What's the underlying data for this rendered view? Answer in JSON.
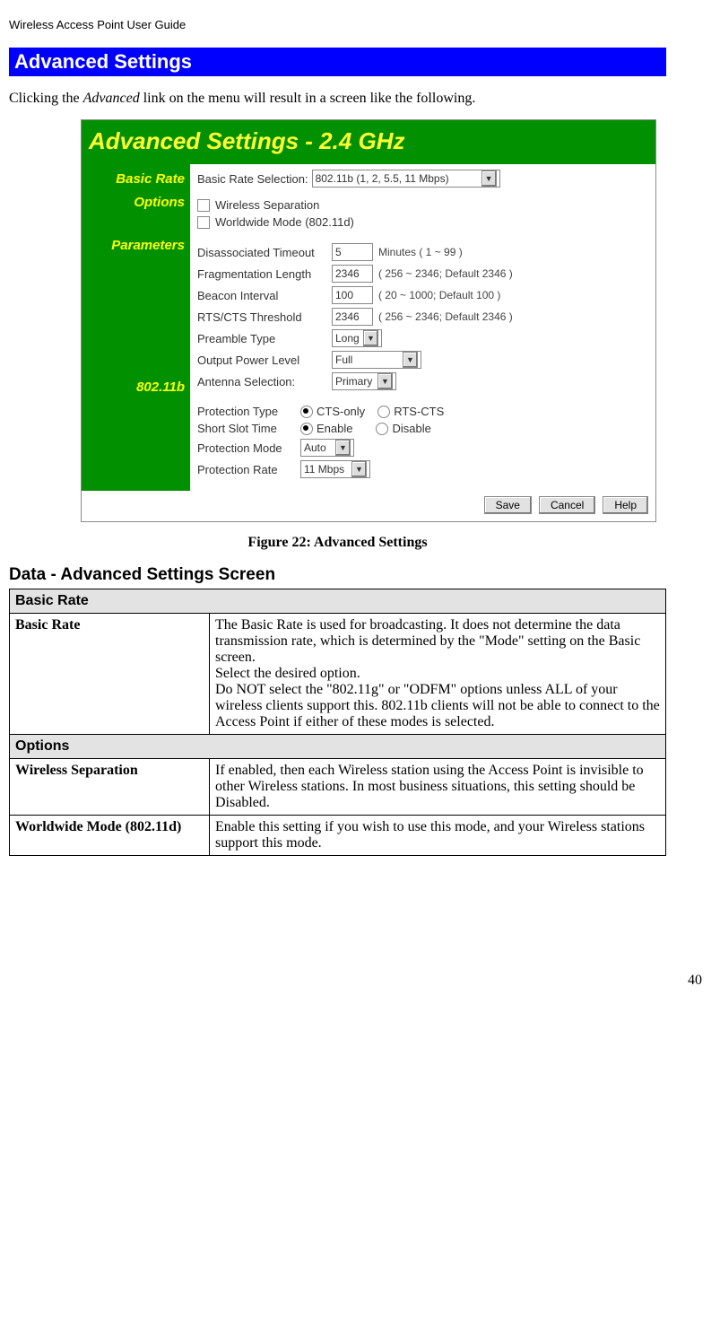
{
  "header": {
    "title": "Wireless Access Point User Guide"
  },
  "section": {
    "title": "Advanced Settings"
  },
  "intro": {
    "pre": "Clicking the ",
    "link": "Advanced",
    "post": " link on the menu will result in a screen like the following."
  },
  "figure": {
    "panel_title": "Advanced Settings - 2.4 GHz",
    "left_labels": {
      "basic_rate": "Basic Rate",
      "options": "Options",
      "parameters": "Parameters",
      "eight02_11b": "802.11b"
    },
    "basic_rate": {
      "label": "Basic Rate Selection:",
      "value": "802.11b (1, 2, 5.5, 11 Mbps)"
    },
    "options": {
      "wireless_sep": "Wireless Separation",
      "worldwide": "Worldwide Mode (802.11d)"
    },
    "parameters": {
      "disassoc_label": "Disassociated Timeout",
      "disassoc_value": "5",
      "disassoc_hint": "Minutes ( 1 ~ 99 )",
      "frag_label": "Fragmentation Length",
      "frag_value": "2346",
      "frag_hint": "( 256 ~ 2346; Default 2346 )",
      "beacon_label": "Beacon Interval",
      "beacon_value": "100",
      "beacon_hint": "( 20 ~ 1000; Default 100 )",
      "rts_label": "RTS/CTS Threshold",
      "rts_value": "2346",
      "rts_hint": "( 256 ~ 2346; Default 2346 )",
      "preamble_label": "Preamble Type",
      "preamble_value": "Long",
      "output_label": "Output Power Level",
      "output_value": "Full",
      "antenna_label": "Antenna Selection:",
      "antenna_value": "Primary"
    },
    "eight02_11b": {
      "prot_type_label": "Protection Type",
      "prot_type_cts": "CTS-only",
      "prot_type_rts": "RTS-CTS",
      "slot_label": "Short Slot Time",
      "slot_enable": "Enable",
      "slot_disable": "Disable",
      "prot_mode_label": "Protection Mode",
      "prot_mode_value": "Auto",
      "prot_rate_label": "Protection Rate",
      "prot_rate_value": "11 Mbps"
    },
    "buttons": {
      "save": "Save",
      "cancel": "Cancel",
      "help": "Help"
    },
    "caption": "Figure 22: Advanced Settings"
  },
  "table": {
    "heading": "Data - Advanced Settings Screen",
    "cat_basic_rate": "Basic Rate",
    "row_basic_rate": {
      "key": "Basic Rate",
      "desc": "The Basic Rate is used for broadcasting. It does not determine the data transmission rate, which is determined by the \"Mode\" setting on the Basic screen.\nSelect the desired option.\nDo NOT select the \"802.11g\" or \"ODFM\" options unless ALL of your wireless clients support this. 802.11b clients will not be able to connect to the Access Point if either of these modes is selected."
    },
    "cat_options": "Options",
    "row_ws": {
      "key": "Wireless Separation",
      "desc": "If enabled, then each Wireless station using the Access Point is invisible to other Wireless stations. In most business situations, this setting should be Disabled."
    },
    "row_wwm": {
      "key": "Worldwide Mode (802.11d)",
      "desc": "Enable this setting if you wish to use this mode, and your Wireless stations support this mode."
    }
  },
  "page_number": "40"
}
